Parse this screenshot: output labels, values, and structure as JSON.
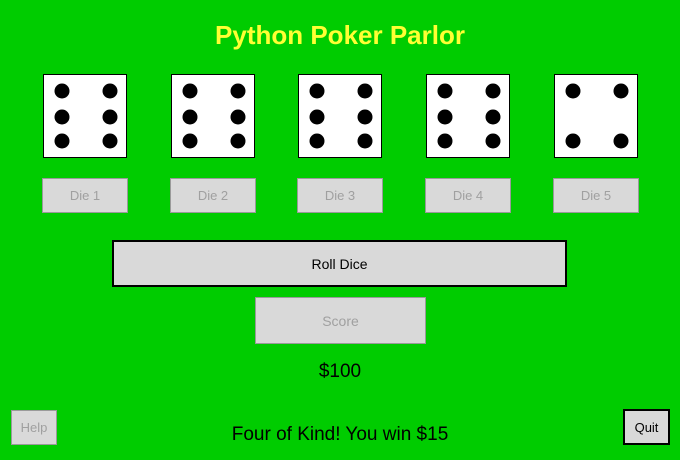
{
  "title": "Python Poker Parlor",
  "colors": {
    "background": "#00cc00",
    "title": "#ffff33",
    "button_bg": "#d9d9d9",
    "disabled_text": "#a0a0a0"
  },
  "dice": [
    {
      "value": 6,
      "label": "Die 1"
    },
    {
      "value": 6,
      "label": "Die 2"
    },
    {
      "value": 6,
      "label": "Die 3"
    },
    {
      "value": 6,
      "label": "Die 4"
    },
    {
      "value": 4,
      "label": "Die 5"
    }
  ],
  "buttons": {
    "roll": "Roll Dice",
    "score": "Score",
    "help": "Help",
    "quit": "Quit"
  },
  "money": "$100",
  "message": "Four of Kind! You win $15"
}
